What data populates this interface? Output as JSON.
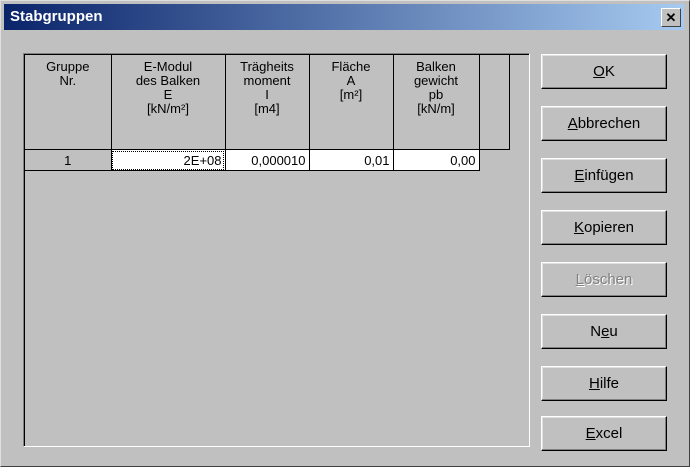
{
  "window": {
    "title": "Stabgruppen",
    "close_glyph": "✕"
  },
  "table": {
    "headers": [
      [
        "Gruppe",
        "Nr."
      ],
      [
        "E-Modul",
        "des Balken",
        "E",
        "[kN/m²]"
      ],
      [
        "Trägheits",
        "moment",
        "I",
        "[m4]"
      ],
      [
        "Fläche",
        "A",
        "[m²]"
      ],
      [
        "Balken",
        "gewicht",
        "pb",
        "[kN/m]"
      ]
    ],
    "rows": [
      [
        "1",
        "2E+08",
        "0,000010",
        "0,01",
        "0,00"
      ]
    ]
  },
  "buttons": [
    {
      "label_pre": "",
      "mnemonic": "O",
      "label_post": "K",
      "enabled": true
    },
    {
      "label_pre": "",
      "mnemonic": "A",
      "label_post": "bbrechen",
      "enabled": true
    },
    {
      "label_pre": "",
      "mnemonic": "E",
      "label_post": "infügen",
      "enabled": true
    },
    {
      "label_pre": "",
      "mnemonic": "K",
      "label_post": "opieren",
      "enabled": true
    },
    {
      "label_pre": "",
      "mnemonic": "L",
      "label_post": "öschen",
      "enabled": false
    },
    {
      "label_pre": "N",
      "mnemonic": "e",
      "label_post": "u",
      "enabled": true
    },
    {
      "label_pre": "",
      "mnemonic": "H",
      "label_post": "ilfe",
      "enabled": true
    },
    {
      "label_pre": "",
      "mnemonic": "E",
      "label_post": "xcel",
      "enabled": true
    }
  ]
}
